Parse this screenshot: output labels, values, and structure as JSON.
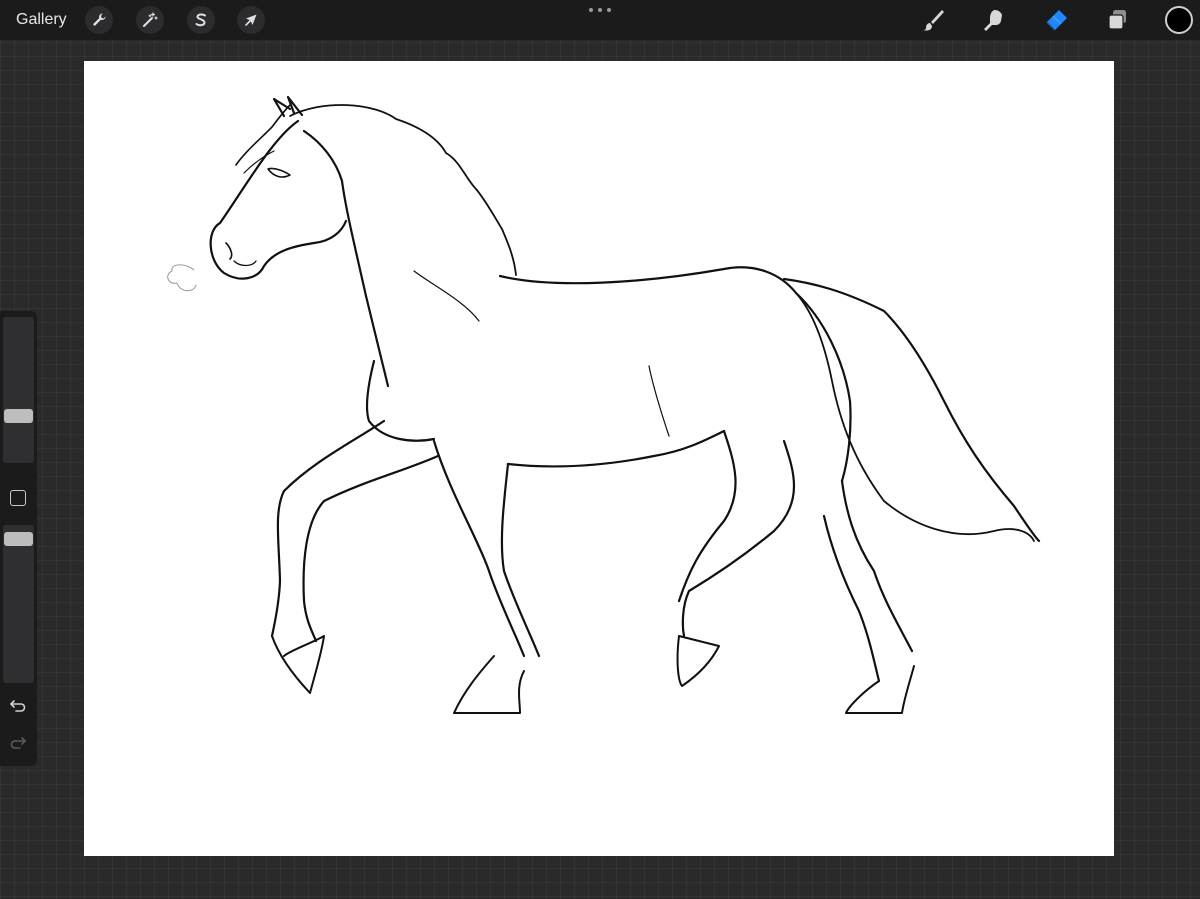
{
  "topbar": {
    "gallery_label": "Gallery",
    "left_tools": [
      {
        "name": "actions",
        "icon": "wrench-icon"
      },
      {
        "name": "adjustments",
        "icon": "magic-wand-icon"
      },
      {
        "name": "selection",
        "icon": "selection-s-icon"
      },
      {
        "name": "transform",
        "icon": "arrow-cursor-icon"
      }
    ],
    "right_tools": [
      {
        "name": "brush",
        "icon": "brush-icon",
        "active": false
      },
      {
        "name": "smudge",
        "icon": "smudge-finger-icon",
        "active": false
      },
      {
        "name": "eraser",
        "icon": "eraser-icon",
        "active": true
      },
      {
        "name": "layers",
        "icon": "layers-icon",
        "active": false
      }
    ],
    "current_color": "#000000",
    "active_color": "#1e88ff"
  },
  "sidebar": {
    "brush_size_level": 0.3,
    "opacity_level": 0.95,
    "icons": [
      "modify-square-icon",
      "undo-icon",
      "redo-icon"
    ]
  },
  "canvas": {
    "background": "#ffffff",
    "drawing": "horse-lineart-illustration"
  }
}
